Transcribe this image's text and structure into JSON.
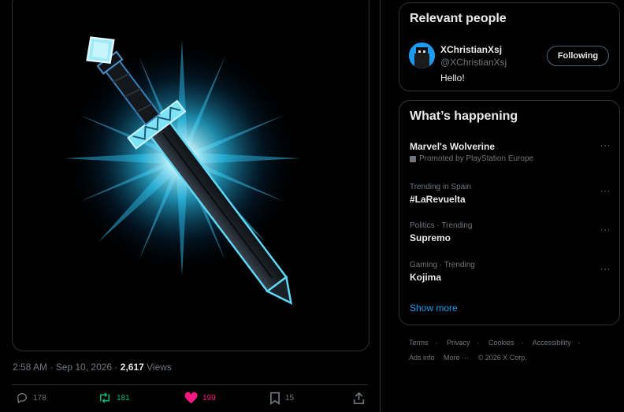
{
  "tweet": {
    "time": "2:58 AM · Sep 10, 2026 · ",
    "views_count": "2,617",
    "views_label": " Views",
    "actions": {
      "reply_count": "178",
      "retweet_count": "181",
      "like_count": "199",
      "bookmark_count": "15"
    }
  },
  "relevant_people": {
    "title": "Relevant people",
    "person": {
      "name": "XChristianXsj",
      "handle": "@XChristianXsj",
      "bio": "Hello!",
      "button_label": "Following"
    }
  },
  "whats_happening": {
    "title": "What’s happening",
    "trends": [
      {
        "context": "",
        "name": "Marvel's Wolverine",
        "promoted": "Promoted by PlayStation Europe"
      },
      {
        "context": "Trending in Spain",
        "name": "#LaRevuelta"
      },
      {
        "context": "Politics · Trending",
        "name": "Supremo"
      },
      {
        "context": "Gaming · Trending",
        "name": "Kojima"
      }
    ],
    "more_icon": "···",
    "show_more": "Show more"
  },
  "footer": {
    "row1": [
      "Terms",
      "Privacy",
      "Cookies",
      "Accessibility"
    ],
    "row2": [
      "Ads info",
      "More ···",
      "© 2026 X Corp."
    ],
    "separator": "·"
  },
  "colors": {
    "accent": "#1d9bf0",
    "retweet": "#00ba7c",
    "like": "#f91880",
    "muted": "#71767b",
    "border": "#2f3336"
  },
  "icons": [
    "reply-icon",
    "retweet-icon",
    "heart-icon",
    "bookmark-icon",
    "share-icon",
    "more-icon",
    "promoted-icon"
  ]
}
